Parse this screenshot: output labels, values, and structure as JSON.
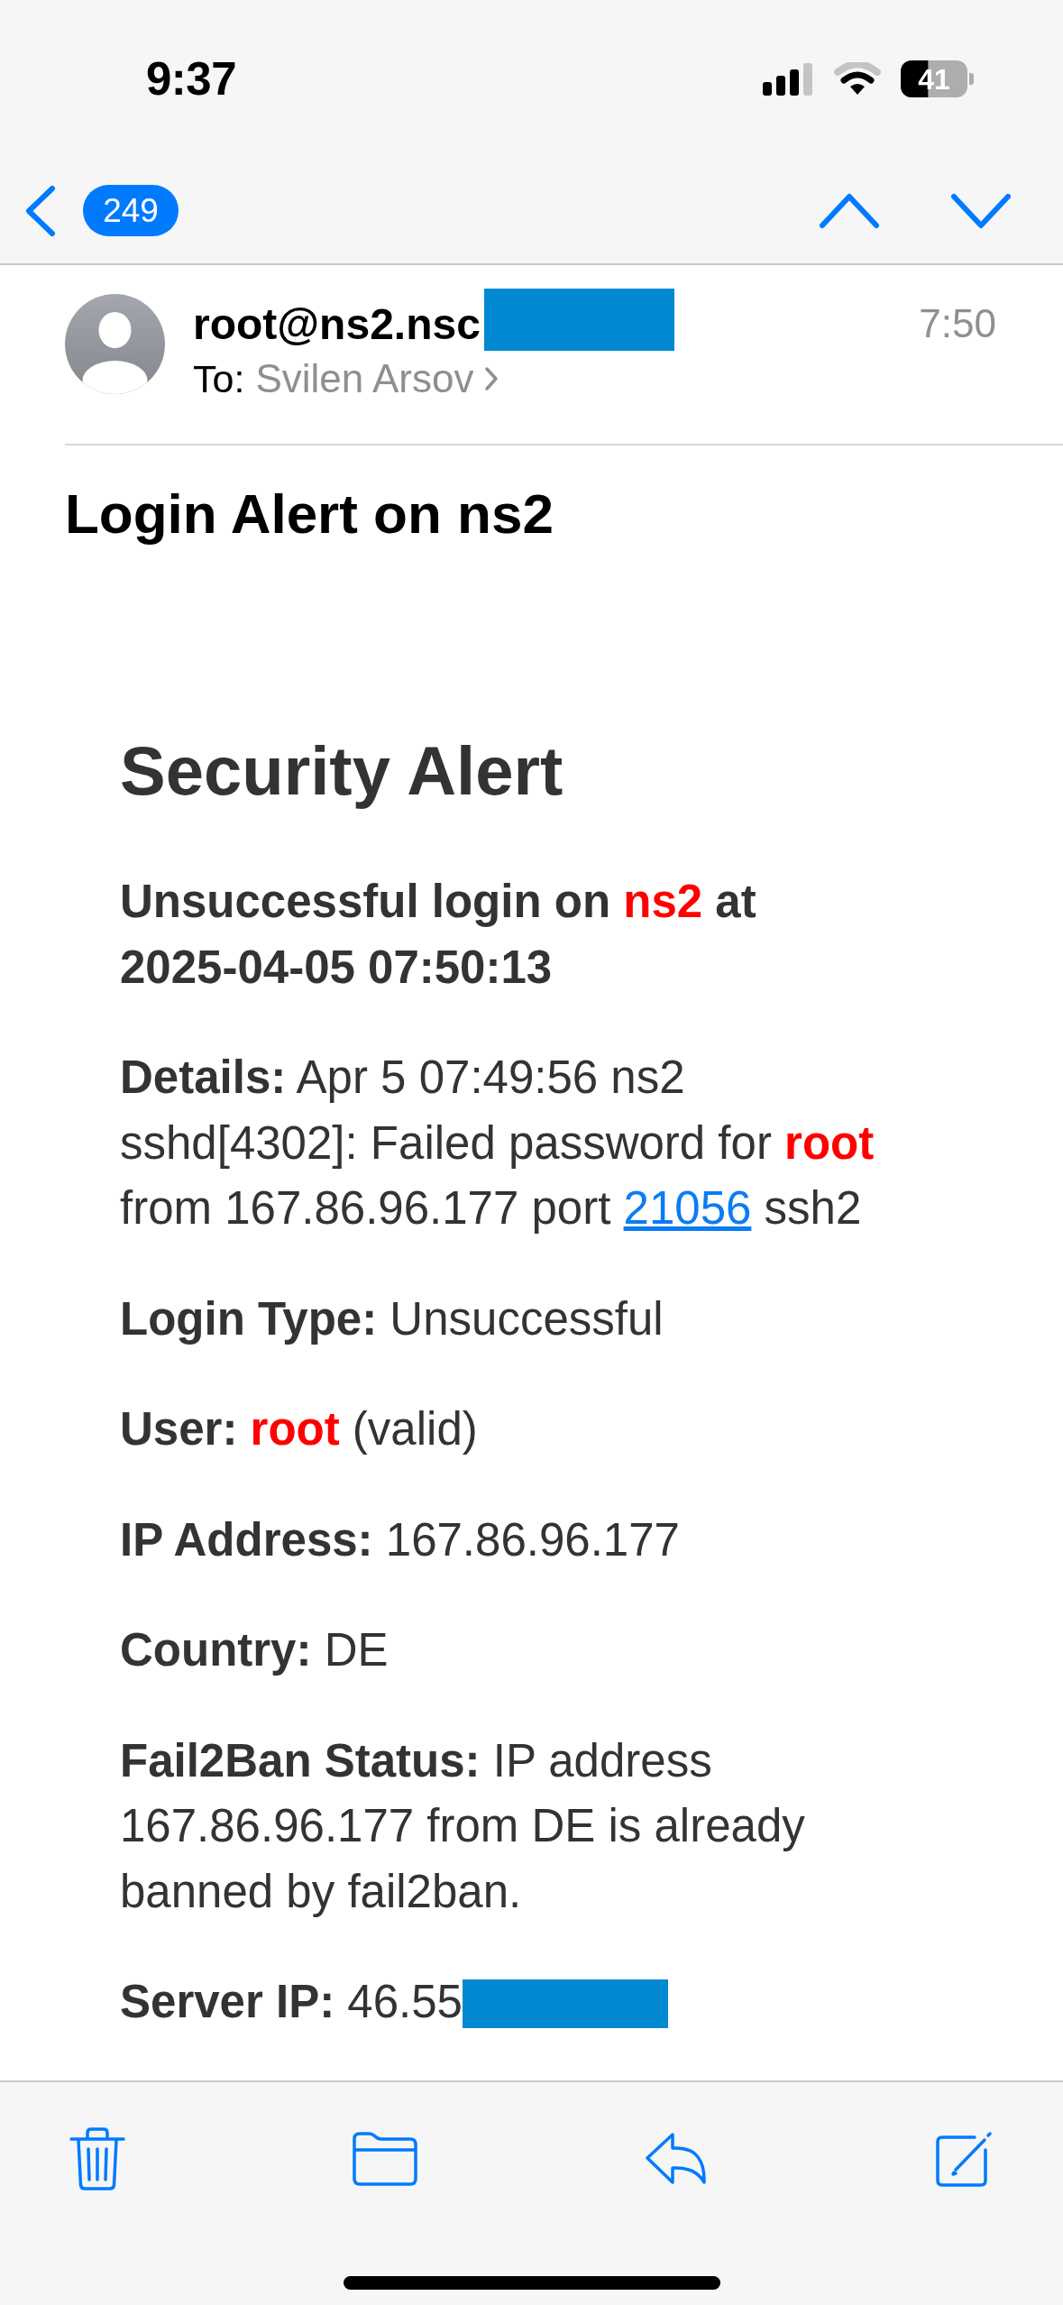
{
  "status_bar": {
    "time": "9:37",
    "battery": "41"
  },
  "nav_bar": {
    "unread_count": "249"
  },
  "message_header": {
    "sender": "root@ns2.nsc",
    "sender_redacted": true,
    "to_label": "To:",
    "recipient": "Svilen Arsov",
    "time": "7:50"
  },
  "subject": "Login Alert on ns2",
  "body": {
    "heading": "Security Alert",
    "paragraphs": [
      {
        "segments": [
          {
            "kind": "strong",
            "text": "Unsuccessful login on "
          },
          {
            "kind": "alert",
            "text": "ns2"
          },
          {
            "kind": "strong",
            "text": " at 2025-04-05 07:50:13"
          }
        ]
      },
      {
        "segments": [
          {
            "kind": "strong",
            "text": "Details:"
          },
          {
            "kind": "plain",
            "text": " Apr 5 07:49:56 ns2 sshd[4302]: Failed password for "
          },
          {
            "kind": "alert",
            "text": "root"
          },
          {
            "kind": "plain",
            "text": " from 167.86.96.177 port "
          },
          {
            "kind": "link",
            "text": "21056"
          },
          {
            "kind": "plain",
            "text": " ssh2"
          }
        ]
      },
      {
        "segments": [
          {
            "kind": "strong",
            "text": "Login Type:"
          },
          {
            "kind": "plain",
            "text": " Unsuccessful"
          }
        ]
      },
      {
        "segments": [
          {
            "kind": "strong",
            "text": "User: "
          },
          {
            "kind": "alert",
            "text": "root"
          },
          {
            "kind": "plain",
            "text": " (valid)"
          }
        ]
      },
      {
        "segments": [
          {
            "kind": "strong",
            "text": "IP Address:"
          },
          {
            "kind": "plain",
            "text": " 167.86.96.177"
          }
        ]
      },
      {
        "segments": [
          {
            "kind": "strong",
            "text": "Country:"
          },
          {
            "kind": "plain",
            "text": " DE"
          }
        ]
      },
      {
        "segments": [
          {
            "kind": "strong",
            "text": "Fail2Ban Status:"
          },
          {
            "kind": "plain",
            "text": " IP address 167.86.96.177 from DE is already banned by fail2ban."
          }
        ]
      },
      {
        "segments": [
          {
            "kind": "strong",
            "text": "Server IP:"
          },
          {
            "kind": "plain",
            "text": " 46.55"
          }
        ],
        "redacted": true
      }
    ]
  }
}
